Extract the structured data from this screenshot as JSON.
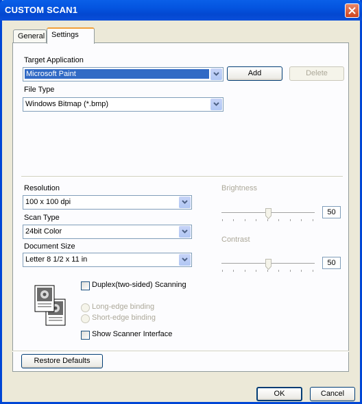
{
  "window": {
    "title": "CUSTOM SCAN1"
  },
  "tabs": [
    {
      "label": "General"
    },
    {
      "label": "Settings"
    }
  ],
  "target_application": {
    "label": "Target Application",
    "value": "Microsoft Paint",
    "add": "Add",
    "delete": "Delete"
  },
  "file_type": {
    "label": "File Type",
    "value": "Windows Bitmap (*.bmp)"
  },
  "resolution": {
    "label": "Resolution",
    "value": "100 x 100 dpi"
  },
  "scan_type": {
    "label": "Scan Type",
    "value": "24bit Color"
  },
  "document_size": {
    "label": "Document Size",
    "value": "Letter 8 1/2 x 11 in"
  },
  "brightness": {
    "label": "Brightness",
    "value": "50",
    "level": 0.5
  },
  "contrast": {
    "label": "Contrast",
    "value": "50",
    "level": 0.5
  },
  "duplex": {
    "label": "Duplex(two-sided) Scanning",
    "checked": false
  },
  "binding": {
    "long": "Long-edge binding",
    "short": "Short-edge binding"
  },
  "scanner_interface": {
    "label": "Show Scanner Interface",
    "checked": false
  },
  "buttons": {
    "restore": "Restore Defaults",
    "ok": "OK",
    "cancel": "Cancel"
  },
  "colors": {
    "titlebar": "#0454df",
    "face": "#ece9d8",
    "selection": "#316ac5"
  }
}
